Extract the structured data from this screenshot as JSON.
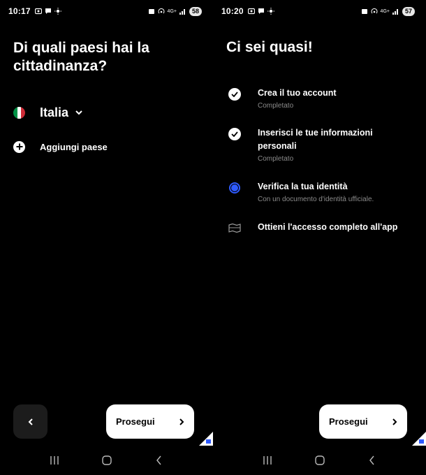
{
  "left_screen": {
    "status": {
      "time": "10:17",
      "battery": "58",
      "net": "4G+"
    },
    "title": "Di quali paesi hai la cittadinanza?",
    "country": {
      "name": "Italia",
      "flag_colors": [
        "#009246",
        "#ffffff",
        "#ce2b37"
      ]
    },
    "add_country_label": "Aggiungi paese",
    "continue_label": "Prosegui"
  },
  "right_screen": {
    "status": {
      "time": "10:20",
      "battery": "57",
      "net": "4G+"
    },
    "title": "Ci sei quasi!",
    "steps": [
      {
        "title": "Crea il tuo account",
        "subtitle": "Completato",
        "state": "completed",
        "icon": "check-circle-icon"
      },
      {
        "title": "Inserisci le tue informazioni personali",
        "subtitle": "Completato",
        "state": "completed",
        "icon": "check-circle-icon"
      },
      {
        "title": "Verifica la tua identità",
        "subtitle": "Con un documento d'identità ufficiale.",
        "state": "current",
        "icon": "radio-selected-icon"
      },
      {
        "title": "Ottieni l'accesso completo all'app",
        "subtitle": "",
        "state": "pending",
        "icon": "flag-outline-icon"
      }
    ],
    "continue_label": "Prosegui"
  },
  "colors": {
    "background": "#000000",
    "accent": "#2f5bff",
    "muted_text": "#8a8a8a",
    "button_bg": "#ffffff"
  }
}
